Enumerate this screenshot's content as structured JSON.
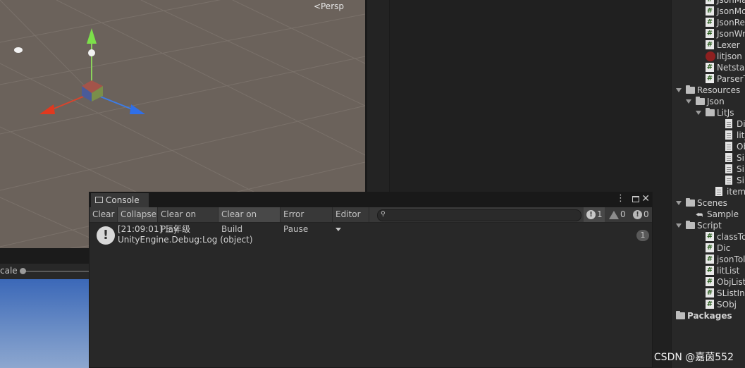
{
  "scene": {
    "projection_label": "Persp"
  },
  "game": {
    "scale_label": "cale"
  },
  "project_tree": [
    {
      "kind": "cs",
      "label": "JsonMa"
    },
    {
      "kind": "cs",
      "label": "JsonMo"
    },
    {
      "kind": "cs",
      "label": "JsonRe"
    },
    {
      "kind": "cs",
      "label": "JsonWr"
    },
    {
      "kind": "cs",
      "label": "Lexer"
    },
    {
      "kind": "dll",
      "label": "litjson"
    },
    {
      "kind": "cs",
      "label": "Netstan"
    },
    {
      "kind": "cs",
      "label": "ParserT"
    },
    {
      "kind": "folder",
      "label": "Resources"
    },
    {
      "kind": "folder",
      "label": "Json"
    },
    {
      "kind": "folder",
      "label": "LitJs"
    },
    {
      "kind": "doc",
      "label": "Di"
    },
    {
      "kind": "doc",
      "label": "lit_"
    },
    {
      "kind": "doc",
      "label": "Ob"
    },
    {
      "kind": "doc",
      "label": "Sir"
    },
    {
      "kind": "doc",
      "label": "Sir"
    },
    {
      "kind": "doc",
      "label": "Sir"
    },
    {
      "kind": "doc",
      "label": "item"
    },
    {
      "kind": "folder",
      "label": "Scenes"
    },
    {
      "kind": "scene",
      "label": "Sample"
    },
    {
      "kind": "folder",
      "label": "Script"
    },
    {
      "kind": "cs",
      "label": "classTo"
    },
    {
      "kind": "cs",
      "label": "Dic"
    },
    {
      "kind": "cs",
      "label": "jsonTol"
    },
    {
      "kind": "cs",
      "label": "litList"
    },
    {
      "kind": "cs",
      "label": "ObjList"
    },
    {
      "kind": "cs",
      "label": "SListInt"
    },
    {
      "kind": "cs",
      "label": "SObj"
    },
    {
      "kind": "folder",
      "label": "Packages"
    }
  ],
  "console": {
    "tab_label": "Console",
    "toolbar": {
      "clear": "Clear",
      "collapse": "Collapse",
      "clear_on_play": "Clear on Play",
      "clear_on_build": "Clear on Build",
      "error_pause": "Error Pause",
      "editor": "Editor",
      "search_placeholder": ""
    },
    "counts": {
      "log": "1",
      "warning": "0",
      "error": "0"
    },
    "log_entry": {
      "line1": "[21:09:01] 三年级",
      "line2": "UnityEngine.Debug:Log (object)",
      "count": "1"
    }
  },
  "watermark": "CSDN @嘉茵552"
}
